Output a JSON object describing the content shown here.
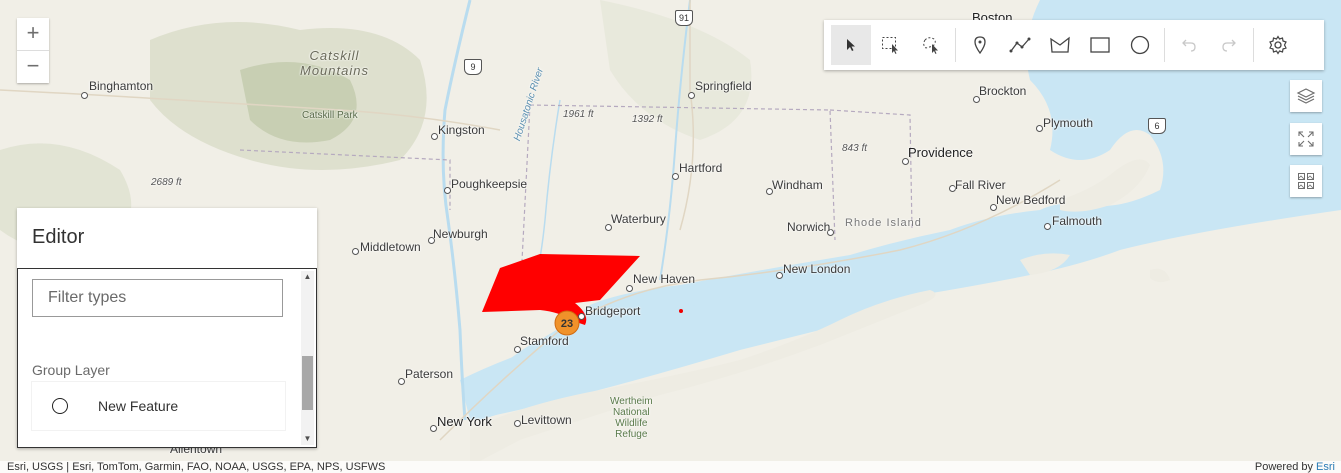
{
  "zoom": {
    "in_label": "+",
    "out_label": "−"
  },
  "places": {
    "binghamton": "Binghamton",
    "catskill_mountains_1": "Catskill",
    "catskill_mountains_2": "Mountains",
    "catskill_park": "Catskill Park",
    "kingston": "Kingston",
    "poughkeepsie": "Poughkeepsie",
    "newburgh": "Newburgh",
    "middletown": "Middletown",
    "paterson": "Paterson",
    "new_york": "New York",
    "levittown": "Levittown",
    "allentown": "Allentown",
    "stamford": "Stamford",
    "bridgeport": "Bridgeport",
    "new_haven": "New Haven",
    "waterbury": "Waterbury",
    "hartford": "Hartford",
    "springfield": "Springfield",
    "windham": "Windham",
    "norwich": "Norwich",
    "new_london": "New London",
    "rhode_island": "Rhode Island",
    "providence": "Providence",
    "fall_river": "Fall River",
    "new_bedford": "New Bedford",
    "falmouth": "Falmouth",
    "plymouth": "Plymouth",
    "brockton": "Brockton",
    "boston": "Boston",
    "housatonic": "Housatonic River",
    "wertheim_1": "Wertheim",
    "wertheim_2": "National",
    "wertheim_3": "Wildlife",
    "wertheim_4": "Refuge",
    "elev_1961": "1961 ft",
    "elev_1392": "1392 ft",
    "elev_843": "843 ft",
    "elev_2689": "2689 ft",
    "route_9": "9",
    "route_91": "91",
    "route_6": "6"
  },
  "cluster": {
    "count": "23",
    "color": "#f0922a"
  },
  "feature_color": "#ff0000",
  "toolbar": {
    "select": "cursor-icon",
    "rect_select": "rectangle-select-icon",
    "lasso_select": "lasso-select-icon",
    "point": "point-icon",
    "polyline": "polyline-icon",
    "polygon": "polygon-icon",
    "rectangle": "rectangle-icon",
    "circle": "circle-icon",
    "undo": "undo-icon",
    "redo": "redo-icon",
    "settings": "gear-icon"
  },
  "editor": {
    "title": "Editor",
    "filter_placeholder": "Filter types",
    "group_label": "Group Layer",
    "feature_label": "New Feature"
  },
  "attribution": {
    "left": "Esri, USGS | Esri, TomTom, Garmin, FAO, NOAA, USGS, EPA, NPS, USFWS",
    "powered": "Powered by ",
    "esri": "Esri"
  }
}
